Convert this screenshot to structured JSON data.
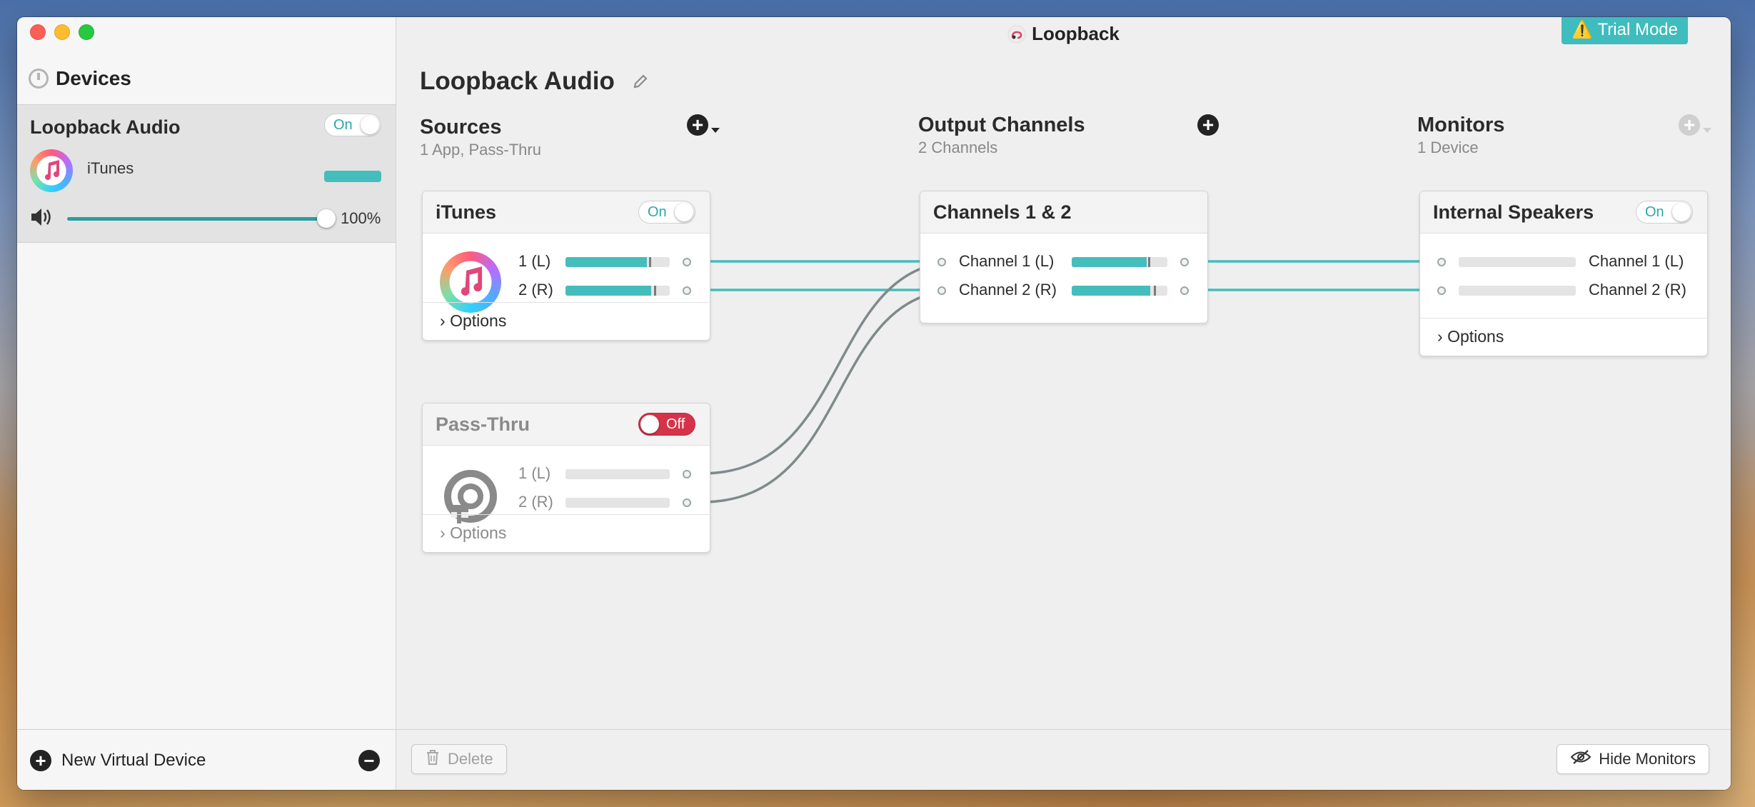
{
  "window": {
    "title": "Loopback",
    "trial_badge": "Trial Mode"
  },
  "sidebar": {
    "header": "Devices",
    "device": {
      "name": "Loopback Audio",
      "toggle": "On",
      "app_name": "iTunes",
      "volume_percent": "100%",
      "volume_level": 1.0
    },
    "new_device_label": "New Virtual Device"
  },
  "main": {
    "device_title": "Loopback Audio",
    "sources": {
      "title": "Sources",
      "subtitle": "1 App, Pass-Thru",
      "cards": [
        {
          "name": "iTunes",
          "toggle": "On",
          "channels": [
            {
              "label": "1 (L)",
              "level": 0.78,
              "peak": 0.8
            },
            {
              "label": "2 (R)",
              "level": 0.82,
              "peak": 0.85
            }
          ],
          "options_label": "Options"
        },
        {
          "name": "Pass-Thru",
          "toggle": "Off",
          "channels": [
            {
              "label": "1 (L)",
              "level": 0,
              "peak": null
            },
            {
              "label": "2 (R)",
              "level": 0,
              "peak": null
            }
          ],
          "options_label": "Options"
        }
      ]
    },
    "output_channels": {
      "title": "Output Channels",
      "subtitle": "2 Channels",
      "card": {
        "name": "Channels 1 & 2",
        "channels": [
          {
            "label": "Channel 1 (L)",
            "level": 0.78,
            "peak": 0.8
          },
          {
            "label": "Channel 2 (R)",
            "level": 0.82,
            "peak": 0.86
          }
        ]
      }
    },
    "monitors": {
      "title": "Monitors",
      "subtitle": "1 Device",
      "card": {
        "name": "Internal Speakers",
        "toggle": "On",
        "channels": [
          {
            "label": "Channel 1 (L)",
            "level": 0
          },
          {
            "label": "Channel 2 (R)",
            "level": 0
          }
        ],
        "options_label": "Options"
      }
    },
    "delete_label": "Delete",
    "hide_monitors_label": "Hide Monitors"
  },
  "colors": {
    "accent": "#45bdbd",
    "toggle_off": "#d6334a",
    "wire_active": "#45bdbd",
    "wire_inactive": "#7f8a8c"
  },
  "icons": [
    "devices-icon",
    "itunes-icon",
    "speaker-icon",
    "pencil-icon",
    "plus-icon",
    "minus-icon",
    "chevron-right-icon",
    "trash-icon",
    "eye-slash-icon",
    "warning-icon",
    "loopback-icon",
    "passthru-icon"
  ]
}
